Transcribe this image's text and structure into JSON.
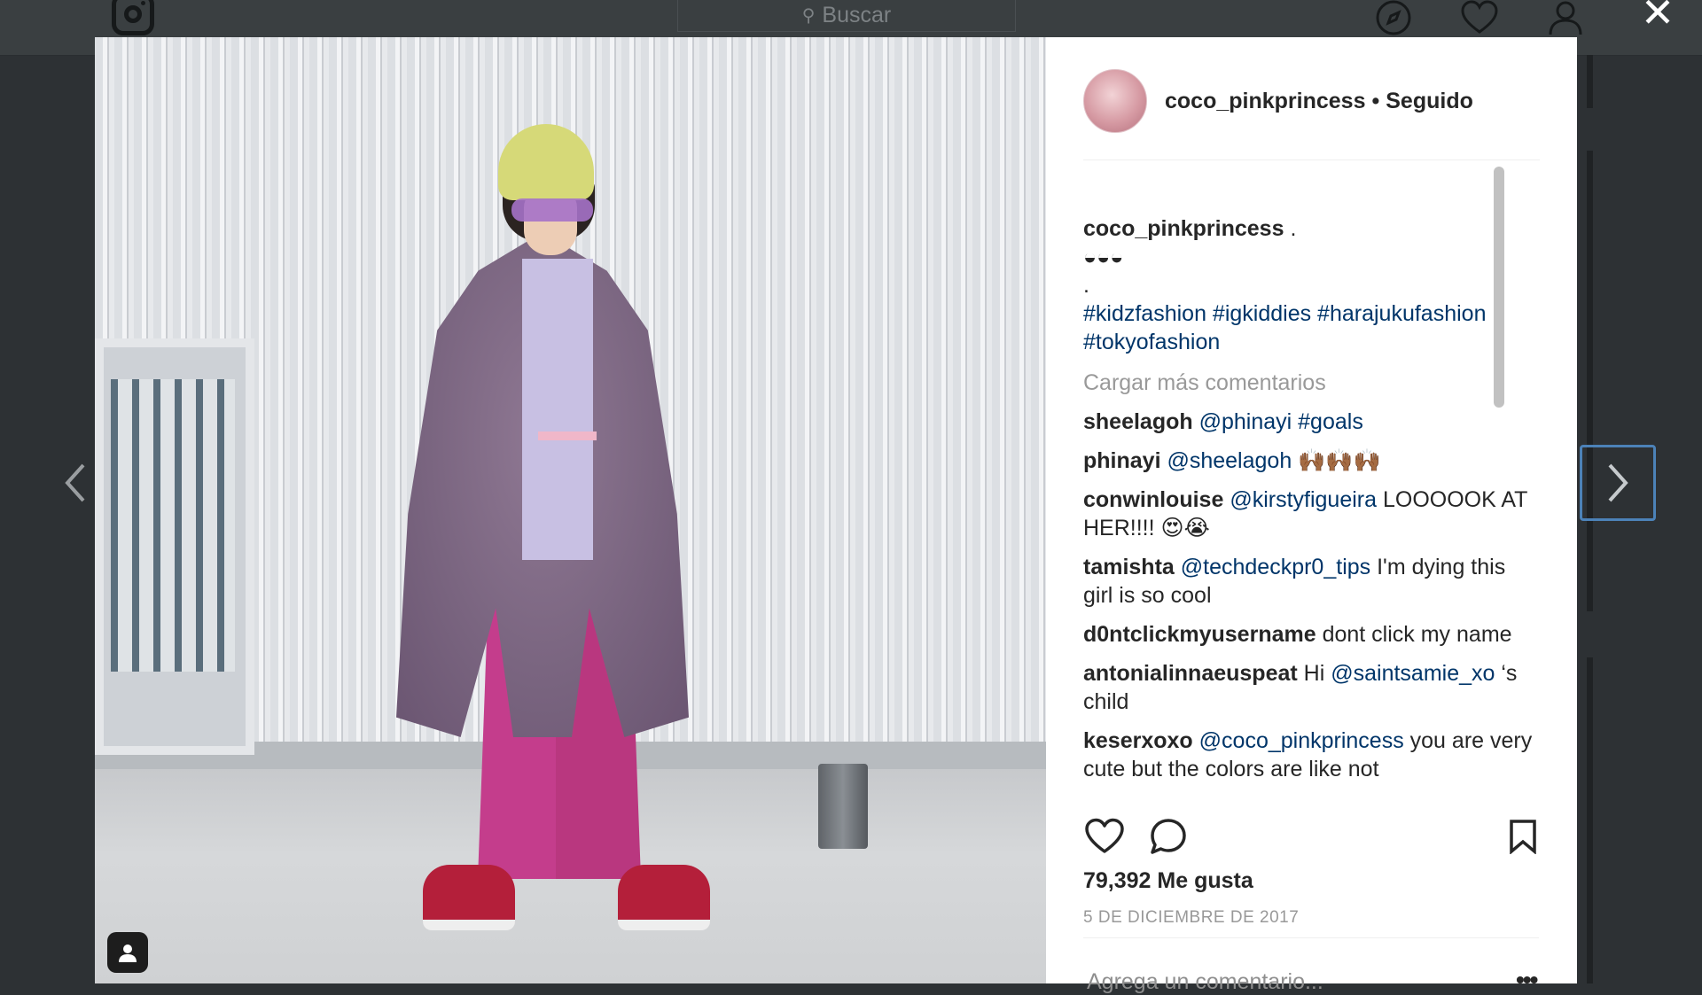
{
  "topbar": {
    "search_placeholder": "Buscar",
    "icons": [
      "instagram-logo-icon",
      "search-icon",
      "compass-icon",
      "heart-icon",
      "profile-icon",
      "close-icon"
    ]
  },
  "post": {
    "username": "coco_pinkprincess",
    "follow_status": "Seguido",
    "caption": {
      "username": "coco_pinkprincess",
      "text": ".",
      "emoji": "◒◒◒",
      "dot": ".",
      "hashtags_line1": "#kidzfashion #igkiddies #harajukufashion",
      "hashtags_line2": "#tokyofashion"
    },
    "load_more": "Cargar más comentarios",
    "comments": [
      {
        "user": "sheelagoh",
        "mention": "@phinayi #goals",
        "text": ""
      },
      {
        "user": "phinayi",
        "mention": "@sheelagoh",
        "text": "🙌🏾🙌🏾🙌🏾"
      },
      {
        "user": "conwinlouise",
        "mention": "@kirstyfigueira",
        "text": "LOOOOOK AT HER!!!! 😍😭"
      },
      {
        "user": "tamishta",
        "mention": "@techdeckpr0_tips",
        "text": "I'm dying this girl is so cool"
      },
      {
        "user": "d0ntclickmyusername",
        "mention": "",
        "text": "dont click my name"
      },
      {
        "user": "antonialinnaeuspeat",
        "mention": "@saintsamie_xo",
        "text": "Hi",
        "text_after": "‘s child"
      },
      {
        "user": "keserxoxo",
        "mention": "@coco_pinkprincess",
        "text": "you are very cute but the colors are like not"
      }
    ],
    "likes": "79,392 Me gusta",
    "date": "5 DE DICIEMBRE DE 2017",
    "add_comment_placeholder": "Agrega un comentario...",
    "more_label": "•••"
  },
  "colors": {
    "overlay_bg": "#2d3134",
    "link": "#003569",
    "muted": "#999999",
    "text": "#262626",
    "focus_border": "#4c82b8"
  }
}
